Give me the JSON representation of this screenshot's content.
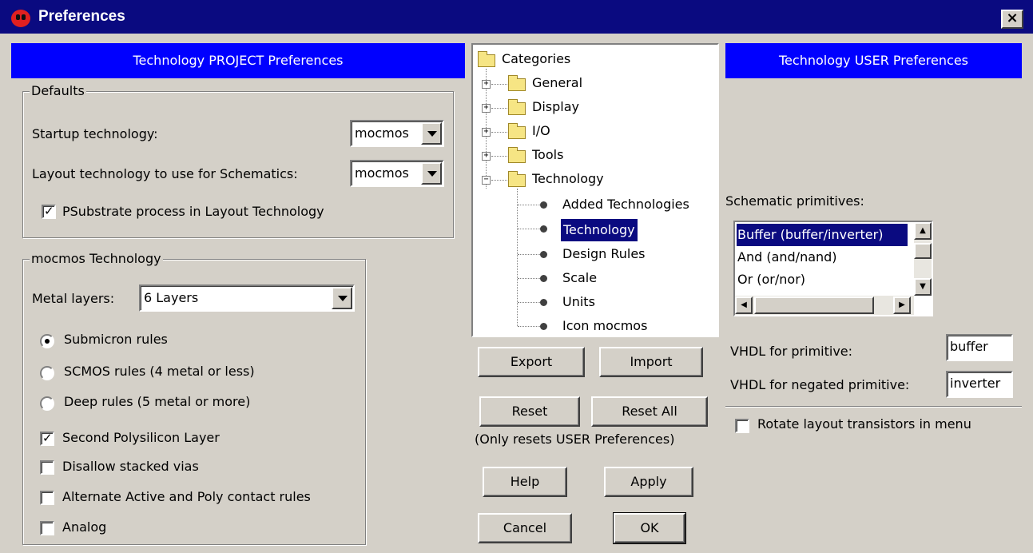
{
  "window": {
    "title": "Preferences",
    "close_label": "×"
  },
  "project_panel": {
    "header": "Technology PROJECT Preferences",
    "defaults": {
      "legend": "Defaults",
      "startup_label": "Startup technology:",
      "startup_value": "mocmos",
      "layout_label": "Layout technology to use for Schematics:",
      "layout_value": "mocmos",
      "psubstrate_label": "PSubstrate process in Layout Technology",
      "psubstrate_checked": true
    },
    "mocmos": {
      "legend": "mocmos Technology",
      "metal_label": "Metal layers:",
      "metal_value": "6 Layers",
      "rules": [
        {
          "label": "Submicron rules",
          "checked": true
        },
        {
          "label": "SCMOS rules (4 metal or less)",
          "checked": false
        },
        {
          "label": "Deep rules (5 metal or more)",
          "checked": false
        }
      ],
      "options": [
        {
          "label": "Second Polysilicon Layer",
          "checked": true
        },
        {
          "label": "Disallow stacked vias",
          "checked": false
        },
        {
          "label": "Alternate Active and Poly contact rules",
          "checked": false
        },
        {
          "label": "Analog",
          "checked": false
        }
      ]
    }
  },
  "tree": {
    "root": "Categories",
    "nodes": [
      {
        "label": "General",
        "expander": "+"
      },
      {
        "label": "Display",
        "expander": "+"
      },
      {
        "label": "I/O",
        "expander": "+"
      },
      {
        "label": "Tools",
        "expander": "+"
      },
      {
        "label": "Technology",
        "expander": "−"
      }
    ],
    "tech_children": [
      "Added Technologies",
      "Technology",
      "Design Rules",
      "Scale",
      "Units",
      "Icon mocmos"
    ],
    "selected": "Technology"
  },
  "buttons": {
    "export": "Export",
    "import": "Import",
    "reset": "Reset",
    "reset_all": "Reset All",
    "reset_note": "(Only resets USER Preferences)",
    "help": "Help",
    "apply": "Apply",
    "cancel": "Cancel",
    "ok": "OK"
  },
  "user_panel": {
    "header": "Technology USER Preferences",
    "primitives_label": "Schematic primitives:",
    "primitives": [
      "Buffer  (buffer/inverter)",
      "And  (and/nand)",
      "Or  (or/nor)"
    ],
    "vhdl_label": "VHDL for primitive:",
    "vhdl_value": "buffer",
    "vhdl_neg_label": "VHDL for negated primitive:",
    "vhdl_neg_value": "inverter",
    "rotate_label": "Rotate layout transistors in menu",
    "rotate_checked": false
  }
}
